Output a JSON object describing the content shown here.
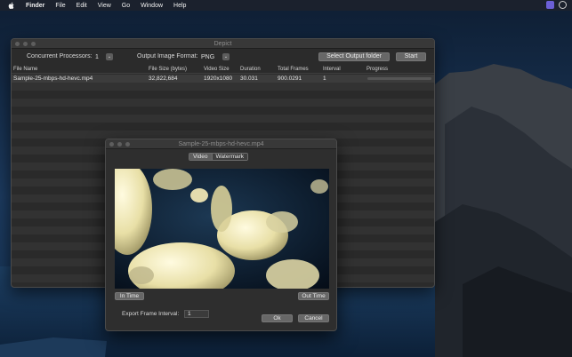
{
  "menubar": {
    "app_name": "Finder",
    "items": [
      "File",
      "Edit",
      "View",
      "Go",
      "Window",
      "Help"
    ],
    "icons": [
      "apple-icon",
      "sidebar-icon",
      "cc-icon"
    ]
  },
  "main_window": {
    "title": "Depict",
    "toolbar": {
      "processors_label": "Concurrent Processors:",
      "processors_value": "1",
      "format_label": "Output Image Format:",
      "format_value": "PNG",
      "select_folder_label": "Select Output folder",
      "start_label": "Start"
    },
    "table": {
      "columns": [
        "File Name",
        "File Size (bytes)",
        "Video Size",
        "Duration",
        "Total Frames",
        "Interval",
        "Progress"
      ],
      "rows": [
        {
          "file_name": "Sample-25-mbps-hd-hevc.mp4",
          "file_size": "32,822,684",
          "video_size": "1920x1080",
          "duration": "30.031",
          "total_frames": "900.0291",
          "interval": "1",
          "progress": 0
        }
      ]
    }
  },
  "preview_dialog": {
    "title": "Sample-25-mbps-hd-hevc.mp4",
    "tabs": [
      "Video",
      "Watermark"
    ],
    "selected_tab": "Video",
    "in_time_label": "In Time",
    "out_time_label": "Out Time",
    "export_interval_label": "Export Frame Interval:",
    "export_interval_value": "1",
    "ok_label": "Ok",
    "cancel_label": "Cancel"
  }
}
